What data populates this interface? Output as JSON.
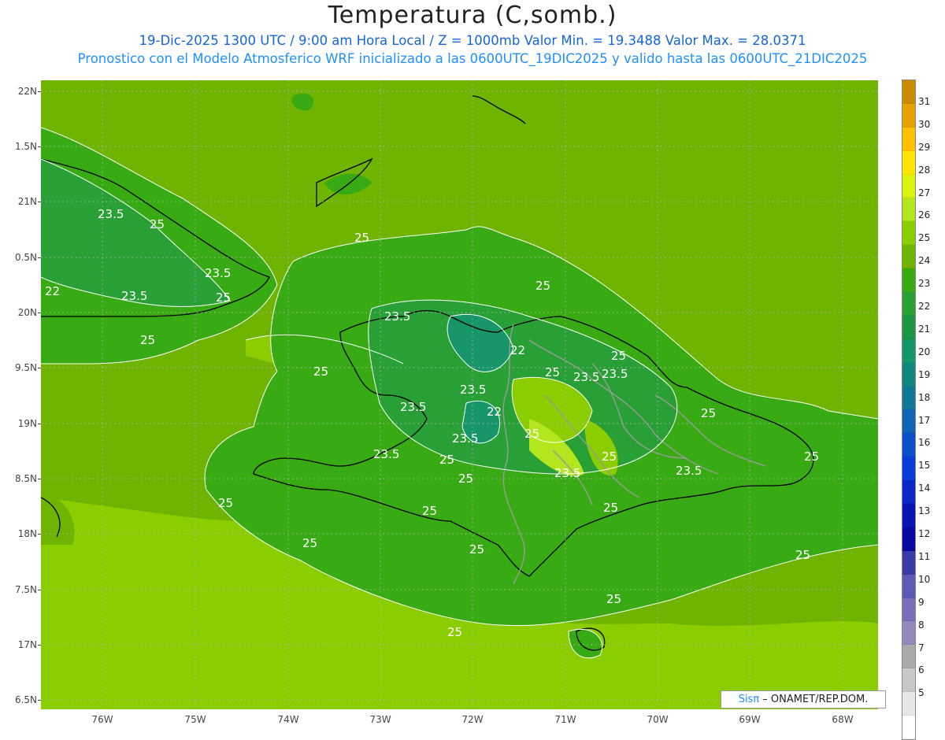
{
  "title": "Temperatura (C,somb.)",
  "subtitle_line1": "19-Dic-2025  1300 UTC / 9:00 am Hora Local / Z = 1000mb   Valor Min. = 19.3488  Valor Max. = 28.0371",
  "subtitle_line2": "Pronostico con el Modelo Atmosferico WRF inicializado a las 0600UTC_19DIC2025 y valido hasta las  0600UTC_21DIC2025",
  "lat_labels": [
    "22N",
    "1.5N",
    "21N",
    "0.5N",
    "20N",
    "9.5N",
    "19N",
    "8.5N",
    "18N",
    "7.5N",
    "17N",
    "6.5N"
  ],
  "lon_labels": [
    "76W",
    "75W",
    "74W",
    "73W",
    "72W",
    "71W",
    "70W",
    "69W",
    "68W"
  ],
  "colorbar": {
    "labels": [
      "31",
      "30",
      "29",
      "28",
      "27",
      "26",
      "25",
      "24",
      "23",
      "22",
      "21",
      "20",
      "19",
      "18",
      "17",
      "16",
      "15",
      "14",
      "13",
      "12",
      "11",
      "10",
      "9",
      "8",
      "7",
      "6",
      "5"
    ],
    "colors": [
      "#c98c00",
      "#e6a200",
      "#ffc000",
      "#ffe600",
      "#dcf20a",
      "#b4e61e",
      "#8ccd00",
      "#6eb400",
      "#37aa14",
      "#28a035",
      "#1e9646",
      "#169669",
      "#14877d",
      "#12789a",
      "#1064b4",
      "#0a50c8",
      "#0a3cdc",
      "#0a28c8",
      "#0a14b4",
      "#0a0aa0",
      "#3a3aa8",
      "#5c5cb4",
      "#7a6eb8",
      "#9688bc",
      "#aaaaaa",
      "#c8c8c8",
      "#e6e6e6",
      "#ffffff"
    ]
  },
  "contour_labels": [
    "23.5",
    "25",
    "25",
    "22",
    "23.5",
    "23.5",
    "25",
    "25",
    "25",
    "25",
    "23.5",
    "22",
    "25",
    "23.5",
    "23.5",
    "25",
    "25",
    "23.5",
    "22",
    "23.5",
    "25",
    "23.5",
    "25",
    "23.5",
    "25",
    "25",
    "23.5",
    "23.5",
    "25",
    "25",
    "25",
    "25",
    "25",
    "25",
    "25",
    "25",
    "25"
  ],
  "credit": {
    "brand": "Sisπ",
    "text": " – ONAMET/REP.DOM."
  }
}
